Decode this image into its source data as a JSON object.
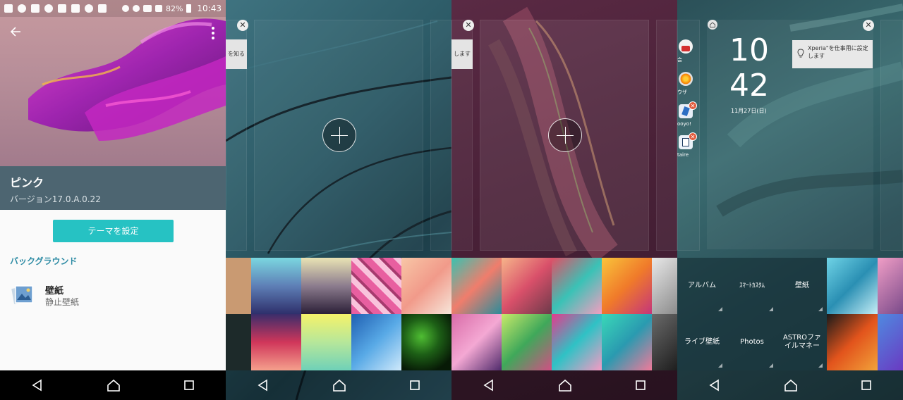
{
  "status_bar": {
    "battery": "82%",
    "time": "10:43"
  },
  "theme_detail": {
    "name": "ピンク",
    "version": "バージョン17.0.A.0.22",
    "set_button": "テーマを設定",
    "section_label": "バックグラウンド",
    "wallpaper_title": "壁紙",
    "wallpaper_subtitle": "静止壁紙"
  },
  "home_edit_1": {
    "tooltip_peek": "を知る",
    "close_glyph": "✕"
  },
  "home_edit_2": {
    "tooltip_peek": "します",
    "close_glyph": "✕"
  },
  "lockscreen": {
    "clock_hour": "10",
    "clock_minute": "42",
    "date": "11月27日(日)",
    "tip": "Xperia\"を仕事用に設定します",
    "apps": [
      {
        "label": "会"
      },
      {
        "label": "ウザ"
      },
      {
        "label": "ooyo!"
      },
      {
        "label": "taire"
      }
    ],
    "menu": [
      "アルバム",
      "ｽﾏｰﾄｶｽﾀﾑ",
      "壁紙",
      "ライブ壁紙",
      "Photos",
      "ASTROファイルマネー"
    ]
  },
  "colors": {
    "accent": "#26c2c3",
    "title_band": "#4d6571",
    "section": "#2d8ba4"
  },
  "icons": [
    "back-arrow-icon",
    "overflow-menu-icon",
    "wallpaper-icon",
    "plus-icon",
    "close-icon",
    "home-icon",
    "bulb-icon",
    "back-icon",
    "recents-icon"
  ]
}
